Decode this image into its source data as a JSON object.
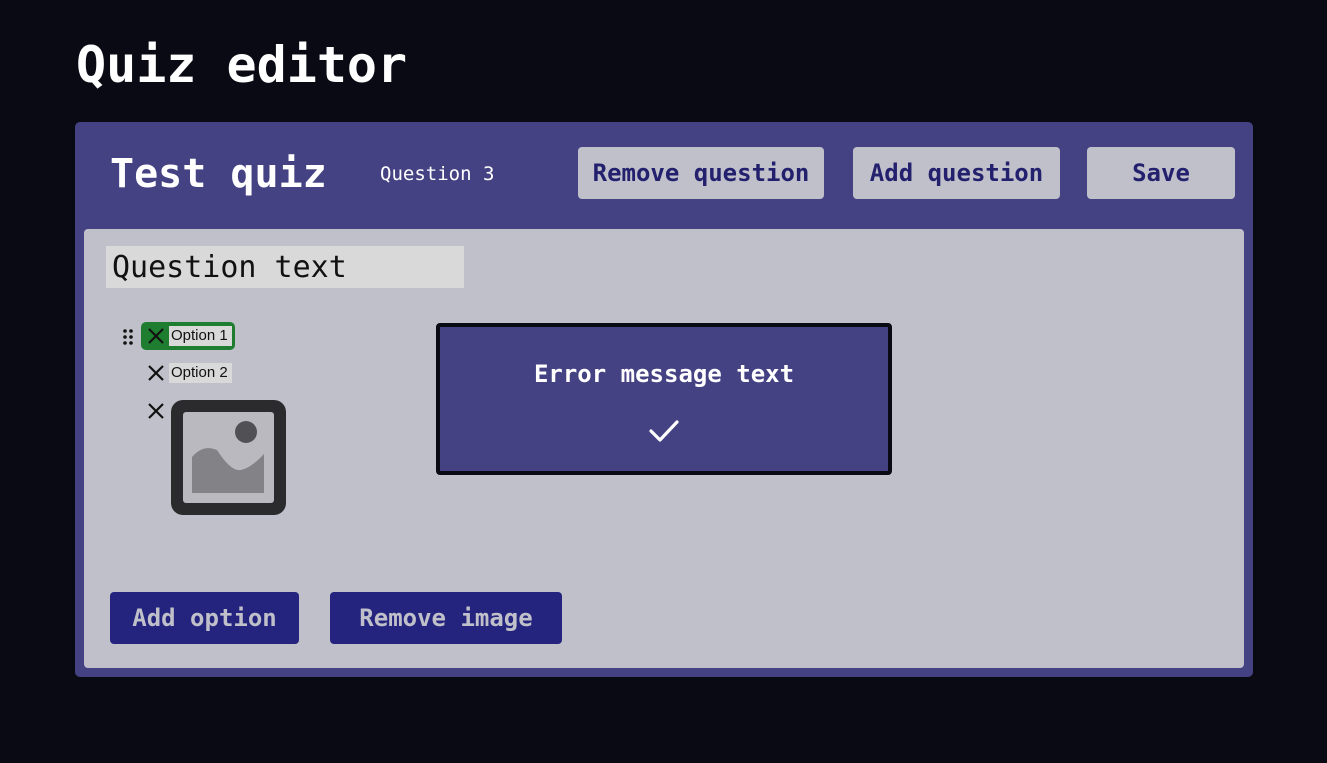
{
  "page": {
    "title": "Quiz editor"
  },
  "header": {
    "quiz_title": "Test quiz",
    "question_indicator": "Question 3",
    "remove_question_label": "Remove question",
    "add_question_label": "Add question",
    "save_label": "Save"
  },
  "question": {
    "text": "Question text",
    "options": [
      {
        "label": "Option 1",
        "correct": true,
        "icon": "close-icon"
      },
      {
        "label": "Option 2",
        "correct": false,
        "icon": "close-icon"
      }
    ],
    "image": {
      "icon": "image-placeholder-icon"
    }
  },
  "error_dialog": {
    "message": "Error message text",
    "confirm_icon": "checkmark-icon"
  },
  "footer": {
    "add_option_label": "Add option",
    "remove_image_label": "Remove image"
  },
  "colors": {
    "background": "#090a14",
    "panel": "#454283",
    "surface": "#c0c0ca",
    "button_dark": "#24237e",
    "correct_highlight": "#1e7d2e"
  }
}
